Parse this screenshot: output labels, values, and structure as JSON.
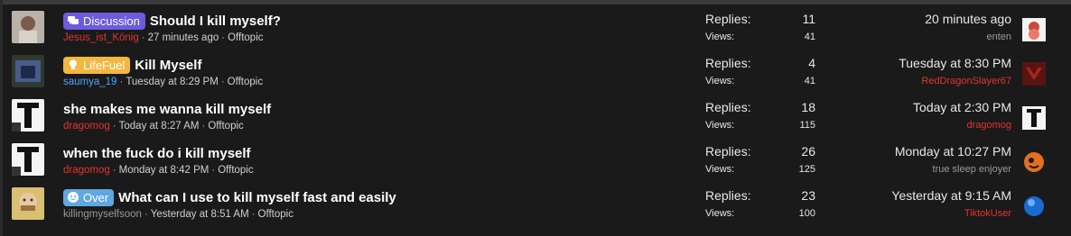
{
  "labels": {
    "replies": "Replies:",
    "views": "Views:"
  },
  "colors": {
    "author_red": "#e0352f",
    "author_blue": "#4ea3ff",
    "author_gray": "#9a9a9a",
    "discussion": "#6c5bdd",
    "lifefuel": "#f4b740",
    "over": "#5fa8e0"
  },
  "threads": [
    {
      "prefix": "Discussion",
      "prefix_icon": "chat-bubbles-icon",
      "title": "Should I kill myself?",
      "author": "Jesus_ist_König",
      "started": "27 minutes ago",
      "forum": "Offtopic",
      "replies": "11",
      "views": "41",
      "last_date": "20 minutes ago",
      "last_user": "enten"
    },
    {
      "prefix": "LifeFuel",
      "prefix_icon": "lightbulb-icon",
      "title": "Kill Myself",
      "author": "saumya_19",
      "started": "Tuesday at 8:29 PM",
      "forum": "Offtopic",
      "replies": "4",
      "views": "41",
      "last_date": "Tuesday at 8:30 PM",
      "last_user": "RedDragonSlayer67"
    },
    {
      "prefix": "",
      "title": "she makes me wanna kill myself",
      "author": "dragomog",
      "started": "Today at 8:27 AM",
      "forum": "Offtopic",
      "replies": "18",
      "views": "115",
      "last_date": "Today at 2:30 PM",
      "last_user": "dragomog"
    },
    {
      "prefix": "",
      "title": "when the fuck do i kill myself",
      "author": "dragomog",
      "started": "Monday at 8:42 PM",
      "forum": "Offtopic",
      "replies": "26",
      "views": "125",
      "last_date": "Monday at 10:27 PM",
      "last_user": "true sleep enjoyer"
    },
    {
      "prefix": "Over",
      "prefix_icon": "smiley-icon",
      "title": "What can I use to kill myself fast and easily",
      "author": "killingmyselfsoon",
      "started": "Yesterday at 8:51 AM",
      "forum": "Offtopic",
      "replies": "23",
      "views": "100",
      "last_date": "Yesterday at 9:15 AM",
      "last_user": "TiktokUser"
    }
  ]
}
